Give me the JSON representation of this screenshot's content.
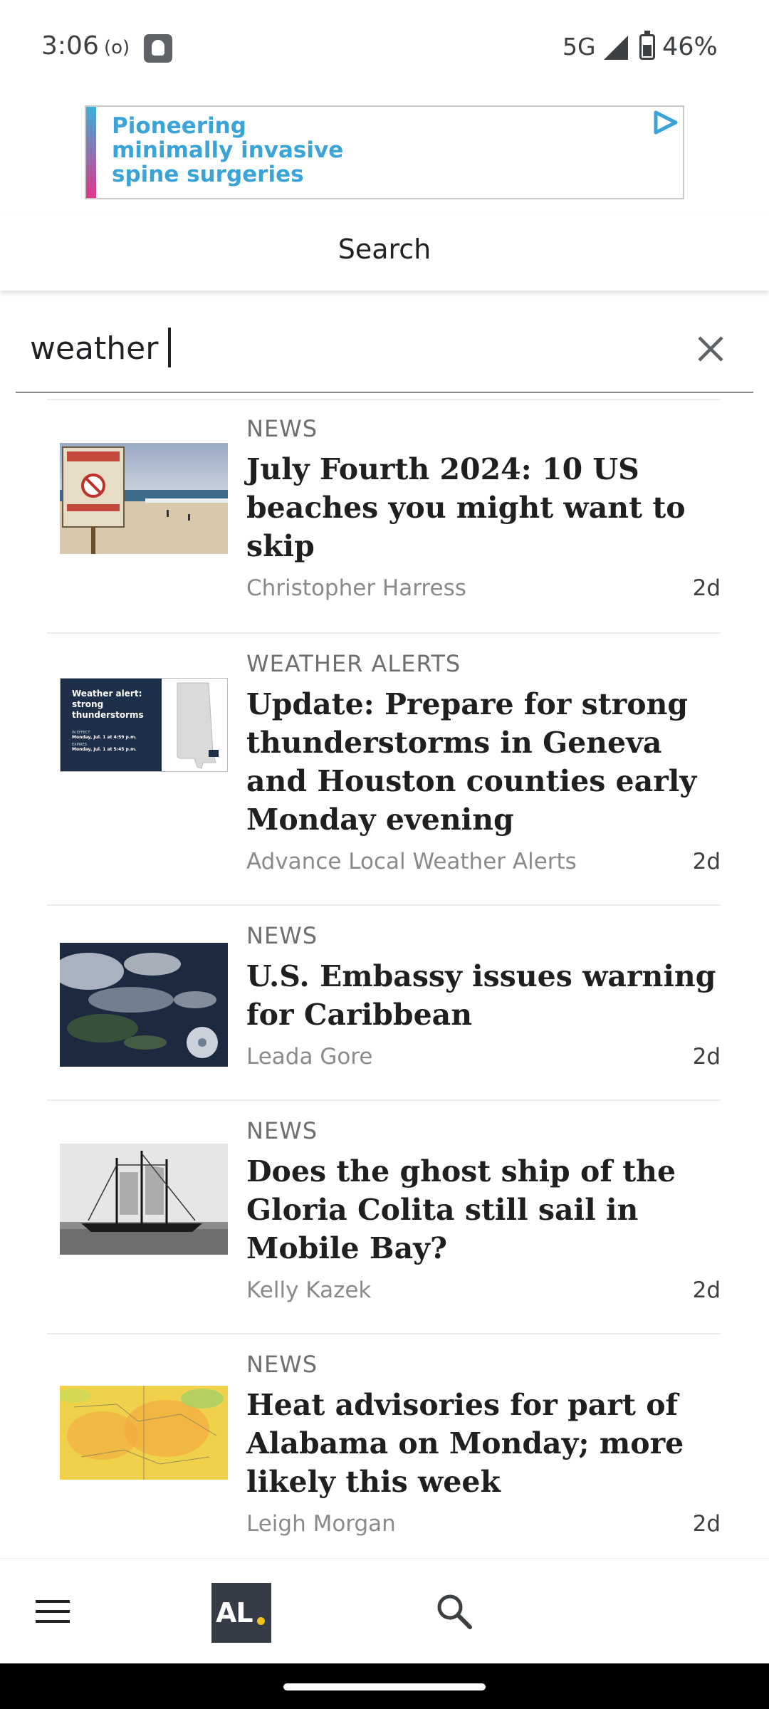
{
  "status_bar": {
    "time": "3:06",
    "radio_indicator": "(o)",
    "network": "5G",
    "battery": "46%",
    "icons": [
      "notification-icon",
      "signal-icon",
      "battery-icon"
    ]
  },
  "ad": {
    "text": "Pioneering minimally invasive spine surgeries",
    "icon": "ad-choices-icon",
    "accent_color": "#3aa3d8"
  },
  "header": {
    "title": "Search"
  },
  "search": {
    "value": "weather",
    "clear_icon": "close-icon"
  },
  "results": [
    {
      "category": "NEWS",
      "headline": "July Fourth 2024: 10 US beaches you might want to skip",
      "author": "Christopher Harress",
      "age": "2d",
      "thumbnail": "beach-warning-sign-photo"
    },
    {
      "category": "WEATHER ALERTS",
      "headline": "Update: Prepare for strong thunderstorms in Geneva and Houston counties early Monday evening",
      "author": "Advance Local Weather Alerts",
      "age": "2d",
      "thumbnail": "weather-alert-card",
      "thumbnail_text": {
        "title": "Weather alert: strong thunderstorms",
        "line1_label": "IN EFFECT",
        "line1": "Monday, Jul. 1 at 4:59 p.m.",
        "line2_label": "EXPIRES",
        "line2": "Monday, Jul. 1 at 5:45 p.m."
      }
    },
    {
      "category": "NEWS",
      "headline": "U.S. Embassy issues warning for Caribbean",
      "author": "Leada Gore",
      "age": "2d",
      "thumbnail": "satellite-storm-image"
    },
    {
      "category": "NEWS",
      "headline": "Does the ghost ship of the Gloria Colita still sail in Mobile Bay?",
      "author": "Kelly Kazek",
      "age": "2d",
      "thumbnail": "sailing-ship-photo"
    },
    {
      "category": "NEWS",
      "headline": "Heat advisories for part of Alabama on Monday; more likely this week",
      "author": "Leigh Morgan",
      "age": "2d",
      "thumbnail": "heat-map-image"
    }
  ],
  "bottom_nav": {
    "menu_icon": "menu-icon",
    "logo": "AL",
    "search_icon": "search-icon",
    "logo_color": "#353b47",
    "logo_dot_color": "#f2c21a"
  }
}
